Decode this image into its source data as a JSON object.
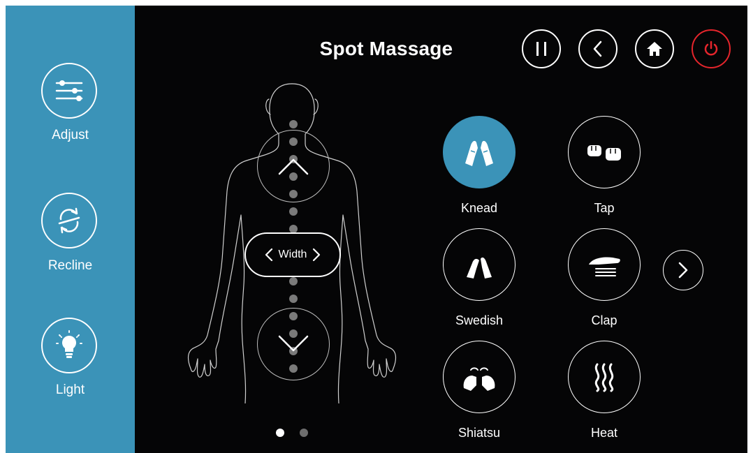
{
  "colors": {
    "accent": "#3b93b8",
    "power": "#e5252c",
    "background": "#050506"
  },
  "sidebar": {
    "items": [
      {
        "label": "Adjust",
        "icon": "sliders-icon"
      },
      {
        "label": "Recline",
        "icon": "cycle-arrows-icon"
      },
      {
        "label": "Light",
        "icon": "lightbulb-icon"
      }
    ]
  },
  "header": {
    "title": "Spot Massage",
    "buttons": [
      {
        "icon": "pause-icon"
      },
      {
        "icon": "back-icon"
      },
      {
        "icon": "home-icon"
      },
      {
        "icon": "power-icon"
      }
    ]
  },
  "body_map": {
    "width_label": "Width",
    "up_icon": "chevron-up-icon",
    "down_icon": "chevron-down-icon",
    "spine_point_count": 15
  },
  "modes": [
    {
      "label": "Knead",
      "icon": "knead-hands-icon",
      "active": true
    },
    {
      "label": "Tap",
      "icon": "tap-fists-icon",
      "active": false
    },
    {
      "label": "Swedish",
      "icon": "swedish-hands-icon",
      "active": false
    },
    {
      "label": "Clap",
      "icon": "clap-hand-icon",
      "active": false
    },
    {
      "label": "Shiatsu",
      "icon": "shiatsu-thumbs-icon",
      "active": false
    },
    {
      "label": "Heat",
      "icon": "heat-waves-icon",
      "active": false
    }
  ],
  "pagination": {
    "pages": 2,
    "current": 1
  }
}
